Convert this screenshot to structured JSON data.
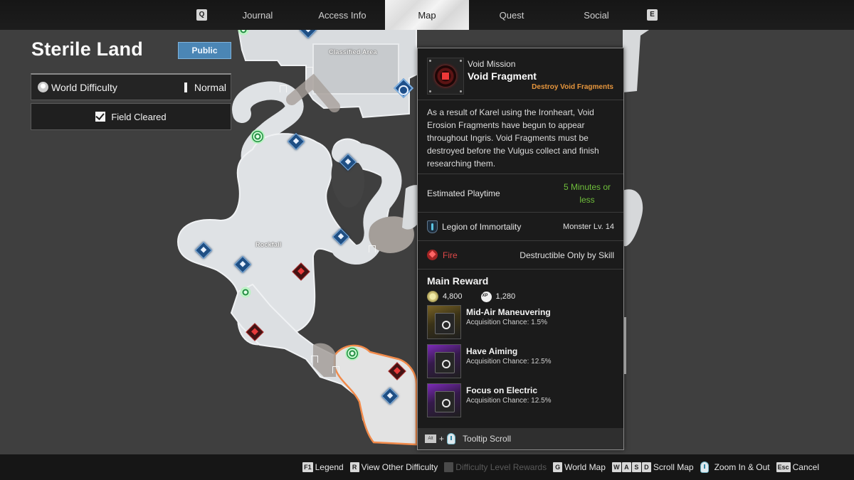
{
  "topnav": {
    "left_key": "Q",
    "right_key": "E",
    "tabs": [
      {
        "label": "Journal",
        "active": false
      },
      {
        "label": "Access Info",
        "active": false
      },
      {
        "label": "Map",
        "active": true
      },
      {
        "label": "Quest",
        "active": false
      },
      {
        "label": "Social",
        "active": false
      }
    ]
  },
  "area": {
    "title": "Sterile Land",
    "visibility_badge": "Public",
    "difficulty_label": "World Difficulty",
    "difficulty_value": "Normal",
    "cleared_label": "Field Cleared",
    "cleared_checked": true
  },
  "map": {
    "labels": [
      "Classified Area",
      "Rockfall"
    ],
    "icons": {
      "outpost": "blue-diamond-flag-icon",
      "research": "green-ring-icon",
      "void": "red-void-fragment-icon",
      "gate": "gate-icon",
      "player": "player-arrow-icon"
    }
  },
  "tooltip": {
    "category": "Void Mission",
    "title": "Void Fragment",
    "objective": "Destroy Void Fragments",
    "description": "As a result of Karel using the Ironheart, Void Erosion Fragments have begun to appear throughout Ingris. Void Fragments must be destroyed before the Vulgus collect and finish researching them.",
    "playtime_label": "Estimated Playtime",
    "playtime_value": "5 Minutes or less",
    "faction": "Legion of Immortality",
    "monster_level": "Monster Lv. 14",
    "element": "Fire",
    "element_note": "Destructible Only by Skill",
    "reward_title": "Main Reward",
    "gold": "4,800",
    "xp": "1,280",
    "rewards": [
      {
        "name": "Mid-Air Maneuvering",
        "chance": "Acquisition Chance: 1.5%",
        "rarity": "gold"
      },
      {
        "name": "Have Aiming",
        "chance": "Acquisition Chance: 12.5%",
        "rarity": "purple"
      },
      {
        "name": "Focus on Electric",
        "chance": "Acquisition Chance: 12.5%",
        "rarity": "purple"
      }
    ],
    "footer_key": "Alt",
    "footer_plus": "+",
    "footer_label": "Tooltip Scroll"
  },
  "bottombar": {
    "hints": [
      {
        "keys": [
          "F1"
        ],
        "label": "Legend",
        "enabled": true
      },
      {
        "keys": [
          "R"
        ],
        "label": "View Other Difficulty",
        "enabled": true
      },
      {
        "keys": [
          ""
        ],
        "label": "Difficulty Level Rewards",
        "enabled": false
      },
      {
        "keys": [
          "G"
        ],
        "label": "World Map",
        "enabled": true
      },
      {
        "keys": [
          "W",
          "A",
          "S",
          "D"
        ],
        "label": "Scroll Map",
        "enabled": true
      },
      {
        "keys": [],
        "label": "Zoom In & Out",
        "enabled": true,
        "mouse": true
      },
      {
        "keys": [
          "Esc"
        ],
        "label": "Cancel",
        "enabled": true
      }
    ]
  },
  "colors": {
    "accent_blue": "#4b86b5",
    "objective_orange": "#e7963d",
    "playtime_green": "#6fbf3b",
    "fire_red": "#e04848"
  }
}
